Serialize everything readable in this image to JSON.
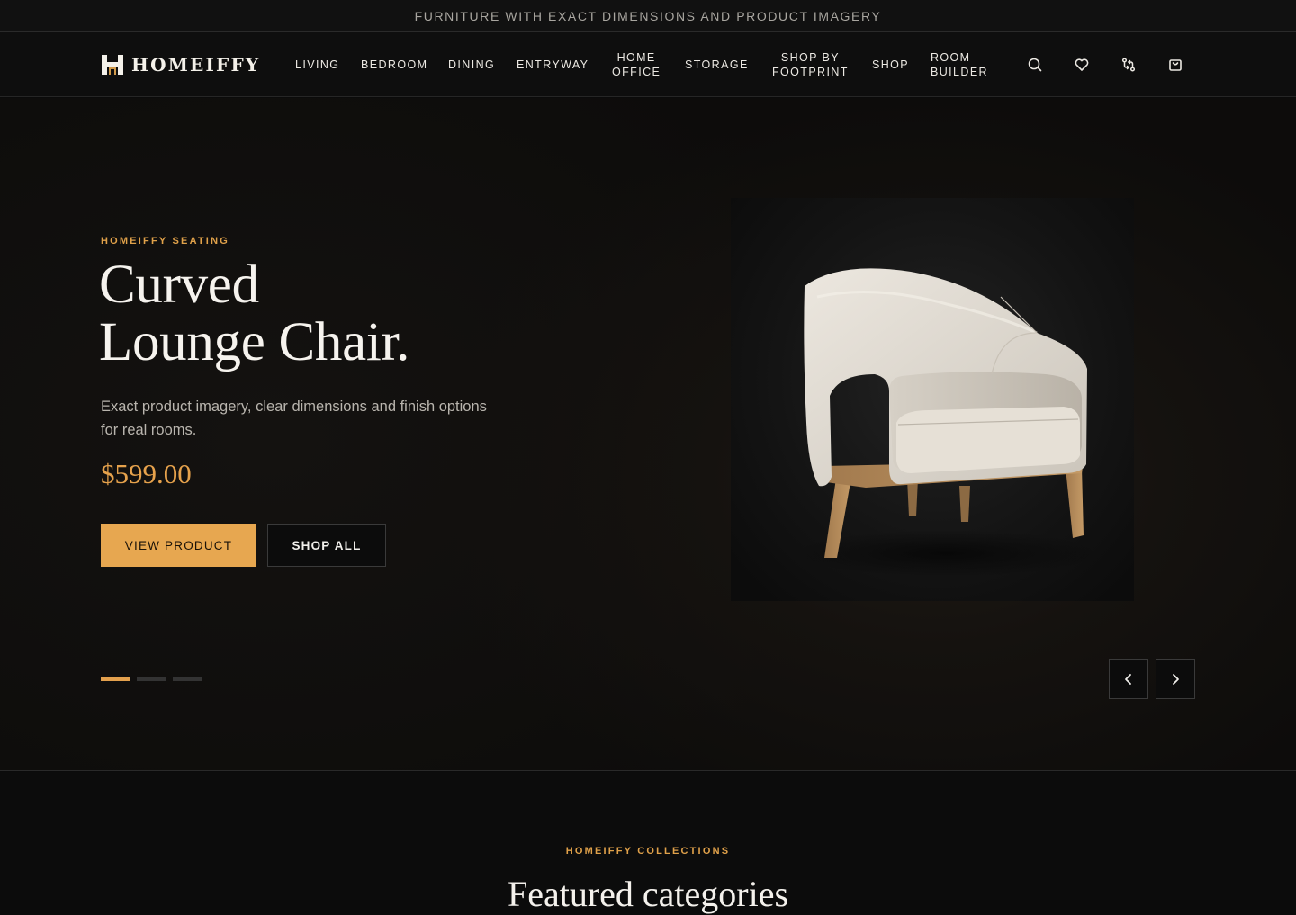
{
  "announcement": "FURNITURE WITH EXACT DIMENSIONS AND PRODUCT IMAGERY",
  "brand": {
    "name": "HOMEIFFY",
    "logo_icon": "homeiffy-logo-icon"
  },
  "nav": {
    "items": [
      {
        "label": "LIVING"
      },
      {
        "label": "BEDROOM"
      },
      {
        "label": "DINING"
      },
      {
        "label": "ENTRYWAY"
      },
      {
        "label": "HOME\nOFFICE"
      },
      {
        "label": "STORAGE"
      },
      {
        "label": "SHOP BY\nFOOTPRINT"
      },
      {
        "label": "SHOP"
      },
      {
        "label": "ROOM\nBUILDER"
      }
    ],
    "icons": [
      "search-icon",
      "heart-icon",
      "compare-icon",
      "cart-icon"
    ]
  },
  "hero": {
    "eyebrow": "HOMEIFFY SEATING",
    "title": "Curved\nLounge Chair.",
    "subtitle": "Exact product imagery, clear dimensions and finish options for real rooms.",
    "price": "$599.00",
    "primary_button": "VIEW PRODUCT",
    "secondary_button": "SHOP ALL",
    "slide_count": 3,
    "active_slide": 1,
    "prev_icon": "chevron-left-icon",
    "next_icon": "chevron-right-icon"
  },
  "collections": {
    "eyebrow": "HOMEIFFY COLLECTIONS",
    "title": "Featured categories"
  },
  "colors": {
    "accent": "#e7a750",
    "background": "#0b0b0b",
    "text": "#f2f0ec"
  }
}
